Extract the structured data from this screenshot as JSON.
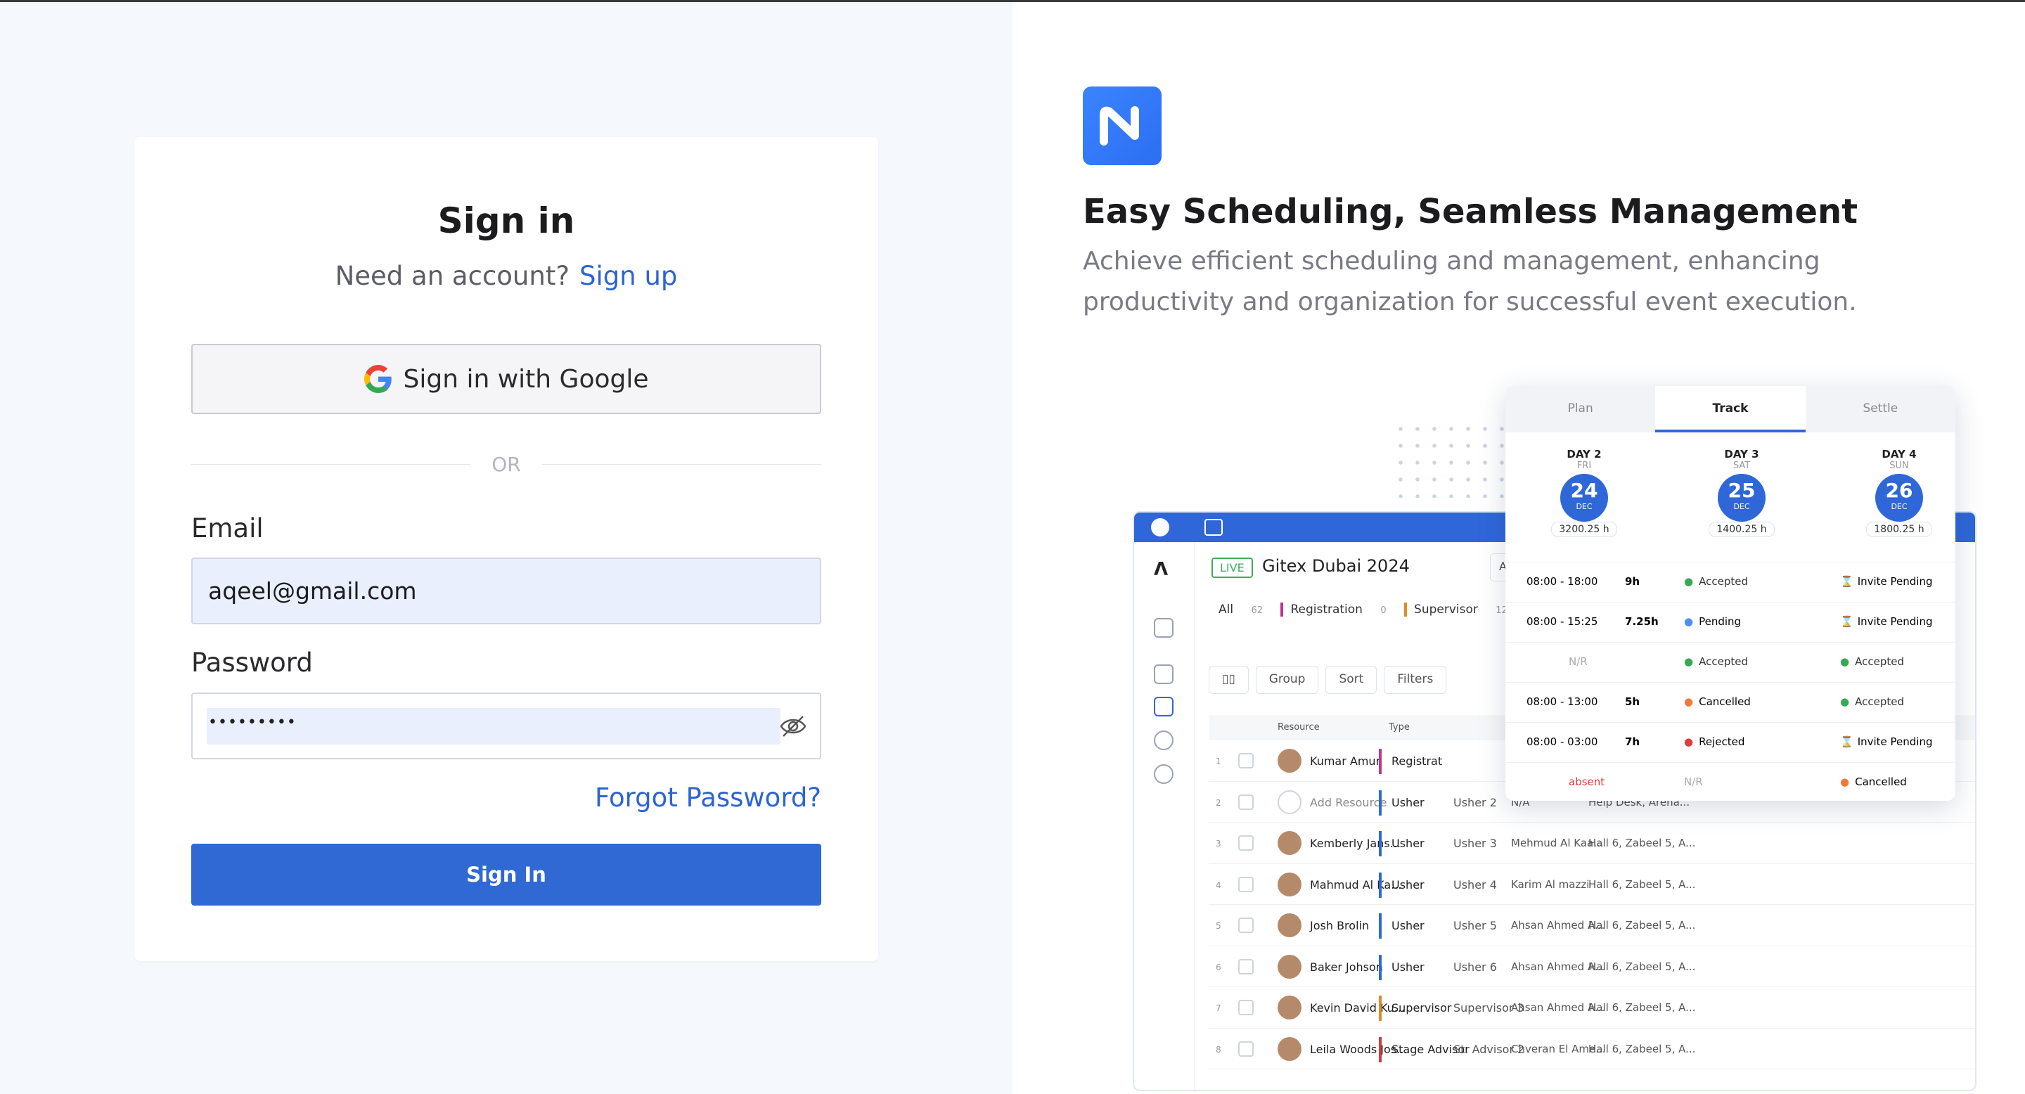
{
  "signin": {
    "title": "Sign in",
    "need_account": "Need an account?",
    "signup_link": "Sign up",
    "google_button": "Sign in with Google",
    "or": "OR",
    "email_label": "Email",
    "email_value": "aqeel@gmail.com",
    "password_label": "Password",
    "password_value": "•••••••••",
    "forgot": "Forgot Password?",
    "submit": "Sign In"
  },
  "promo": {
    "headline": "Easy Scheduling, Seamless Management",
    "subtitle": "Achieve efficient scheduling and management, enhancing productivity and organization for successful event execution."
  },
  "app": {
    "live": "LIVE",
    "event": "Gitex Dubai 2024",
    "venue": "Avens Pal",
    "filters": [
      {
        "label": "All",
        "count": "62"
      },
      {
        "label": "Registration",
        "count": "0"
      },
      {
        "label": "Supervisor",
        "count": "12"
      }
    ],
    "toolbar": {
      "group": "Group",
      "sort": "Sort",
      "filters": "Filters"
    },
    "table_headers": {
      "resource": "Resource",
      "type": "Type"
    },
    "rows": [
      {
        "num": "1",
        "name": "Kumar Amur",
        "type": "Registrat",
        "role": "",
        "mgr": "",
        "loc": ""
      },
      {
        "num": "2",
        "name": "Add Resource",
        "type": "Usher",
        "role": "Usher 2",
        "mgr": "N/A",
        "loc": "Help Desk, Arena..."
      },
      {
        "num": "3",
        "name": "Kemberly Jans...",
        "type": "Usher",
        "role": "Usher 3",
        "mgr": "Mehmud Al Kaa...",
        "loc": "Hall 6, Zabeel 5, A..."
      },
      {
        "num": "4",
        "name": "Mahmud Al Ka...",
        "type": "Usher",
        "role": "Usher 4",
        "mgr": "Karim Al mazzi",
        "loc": "Hall 6, Zabeel 5, A..."
      },
      {
        "num": "5",
        "name": "Josh Brolin",
        "type": "Usher",
        "role": "Usher 5",
        "mgr": "Ahsan Ahmed A...",
        "loc": "Hall 6, Zabeel 5, A..."
      },
      {
        "num": "6",
        "name": "Baker Johson",
        "type": "Usher",
        "role": "Usher 6",
        "mgr": "Ahsan Ahmed A...",
        "loc": "Hall 6, Zabeel 5, A..."
      },
      {
        "num": "7",
        "name": "Kevin David Ku...",
        "type": "Supervisor",
        "role": "Supervisor 3",
        "mgr": "Ahsan Ahmed A...",
        "loc": "Hall 6, Zabeel 5, A..."
      },
      {
        "num": "8",
        "name": "Leila Woods Jos...",
        "type": "Stage Advisor",
        "role": "St. Advisor 2",
        "mgr": "Chveran El Ame...",
        "loc": "Hall 6, Zabeel 5, A..."
      }
    ]
  },
  "schedule": {
    "tabs": [
      "Plan",
      "Track",
      "Settle"
    ],
    "days": [
      {
        "day": "DAY 2",
        "weekday": "FRI",
        "date": "24",
        "month": "DEC",
        "hours": "3200.25 h"
      },
      {
        "day": "DAY 3",
        "weekday": "SAT",
        "date": "25",
        "month": "DEC",
        "hours": "1400.25 h"
      },
      {
        "day": "DAY 4",
        "weekday": "SUN",
        "date": "26",
        "month": "DEC",
        "hours": "1800.25 h"
      }
    ],
    "rows": [
      {
        "time": "08:00  -  18:00",
        "dur": "9h",
        "s1": "Accepted",
        "s1c": "ok",
        "s2": "Invite Pending",
        "s2c": "inv"
      },
      {
        "time": "08:00  -  15:25",
        "dur": "7.25h",
        "s1": "Pending",
        "s1c": "pend",
        "s2": "Invite Pending",
        "s2c": "inv"
      },
      {
        "time": "N/R",
        "dur": "",
        "s1": "Accepted",
        "s1c": "ok",
        "s2": "Accepted",
        "s2c": "ok"
      },
      {
        "time": "08:00  -  13:00",
        "dur": "5h",
        "s1": "Cancelled",
        "s1c": "canc",
        "s2": "Accepted",
        "s2c": "ok"
      },
      {
        "time": "08:00  -  03:00",
        "dur": "7h",
        "s1": "Rejected",
        "s1c": "rej",
        "s2": "Invite Pending",
        "s2c": "inv"
      },
      {
        "time": "absent",
        "dur": "",
        "s1": "N/R",
        "s1c": "muted",
        "s2": "Cancelled",
        "s2c": "canc"
      }
    ]
  },
  "colors": {
    "primary": "#3068d4",
    "link": "#2d64d4",
    "input_fill": "#e9effd"
  }
}
